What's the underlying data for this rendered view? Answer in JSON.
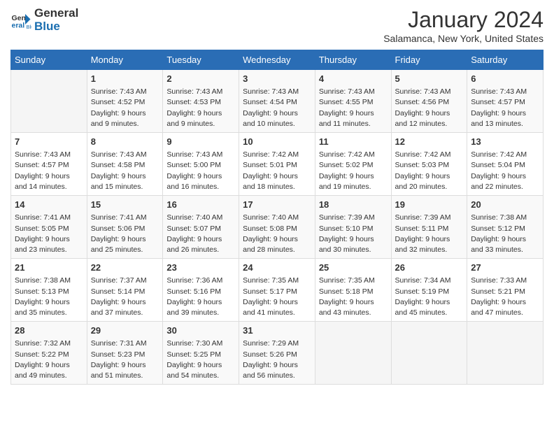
{
  "logo": {
    "line1": "General",
    "line2": "Blue"
  },
  "title": "January 2024",
  "subtitle": "Salamanca, New York, United States",
  "columns": [
    "Sunday",
    "Monday",
    "Tuesday",
    "Wednesday",
    "Thursday",
    "Friday",
    "Saturday"
  ],
  "weeks": [
    [
      {
        "day": "",
        "info": ""
      },
      {
        "day": "1",
        "info": "Sunrise: 7:43 AM\nSunset: 4:52 PM\nDaylight: 9 hours\nand 9 minutes."
      },
      {
        "day": "2",
        "info": "Sunrise: 7:43 AM\nSunset: 4:53 PM\nDaylight: 9 hours\nand 9 minutes."
      },
      {
        "day": "3",
        "info": "Sunrise: 7:43 AM\nSunset: 4:54 PM\nDaylight: 9 hours\nand 10 minutes."
      },
      {
        "day": "4",
        "info": "Sunrise: 7:43 AM\nSunset: 4:55 PM\nDaylight: 9 hours\nand 11 minutes."
      },
      {
        "day": "5",
        "info": "Sunrise: 7:43 AM\nSunset: 4:56 PM\nDaylight: 9 hours\nand 12 minutes."
      },
      {
        "day": "6",
        "info": "Sunrise: 7:43 AM\nSunset: 4:57 PM\nDaylight: 9 hours\nand 13 minutes."
      }
    ],
    [
      {
        "day": "7",
        "info": "Sunrise: 7:43 AM\nSunset: 4:57 PM\nDaylight: 9 hours\nand 14 minutes."
      },
      {
        "day": "8",
        "info": "Sunrise: 7:43 AM\nSunset: 4:58 PM\nDaylight: 9 hours\nand 15 minutes."
      },
      {
        "day": "9",
        "info": "Sunrise: 7:43 AM\nSunset: 5:00 PM\nDaylight: 9 hours\nand 16 minutes."
      },
      {
        "day": "10",
        "info": "Sunrise: 7:42 AM\nSunset: 5:01 PM\nDaylight: 9 hours\nand 18 minutes."
      },
      {
        "day": "11",
        "info": "Sunrise: 7:42 AM\nSunset: 5:02 PM\nDaylight: 9 hours\nand 19 minutes."
      },
      {
        "day": "12",
        "info": "Sunrise: 7:42 AM\nSunset: 5:03 PM\nDaylight: 9 hours\nand 20 minutes."
      },
      {
        "day": "13",
        "info": "Sunrise: 7:42 AM\nSunset: 5:04 PM\nDaylight: 9 hours\nand 22 minutes."
      }
    ],
    [
      {
        "day": "14",
        "info": "Sunrise: 7:41 AM\nSunset: 5:05 PM\nDaylight: 9 hours\nand 23 minutes."
      },
      {
        "day": "15",
        "info": "Sunrise: 7:41 AM\nSunset: 5:06 PM\nDaylight: 9 hours\nand 25 minutes."
      },
      {
        "day": "16",
        "info": "Sunrise: 7:40 AM\nSunset: 5:07 PM\nDaylight: 9 hours\nand 26 minutes."
      },
      {
        "day": "17",
        "info": "Sunrise: 7:40 AM\nSunset: 5:08 PM\nDaylight: 9 hours\nand 28 minutes."
      },
      {
        "day": "18",
        "info": "Sunrise: 7:39 AM\nSunset: 5:10 PM\nDaylight: 9 hours\nand 30 minutes."
      },
      {
        "day": "19",
        "info": "Sunrise: 7:39 AM\nSunset: 5:11 PM\nDaylight: 9 hours\nand 32 minutes."
      },
      {
        "day": "20",
        "info": "Sunrise: 7:38 AM\nSunset: 5:12 PM\nDaylight: 9 hours\nand 33 minutes."
      }
    ],
    [
      {
        "day": "21",
        "info": "Sunrise: 7:38 AM\nSunset: 5:13 PM\nDaylight: 9 hours\nand 35 minutes."
      },
      {
        "day": "22",
        "info": "Sunrise: 7:37 AM\nSunset: 5:14 PM\nDaylight: 9 hours\nand 37 minutes."
      },
      {
        "day": "23",
        "info": "Sunrise: 7:36 AM\nSunset: 5:16 PM\nDaylight: 9 hours\nand 39 minutes."
      },
      {
        "day": "24",
        "info": "Sunrise: 7:35 AM\nSunset: 5:17 PM\nDaylight: 9 hours\nand 41 minutes."
      },
      {
        "day": "25",
        "info": "Sunrise: 7:35 AM\nSunset: 5:18 PM\nDaylight: 9 hours\nand 43 minutes."
      },
      {
        "day": "26",
        "info": "Sunrise: 7:34 AM\nSunset: 5:19 PM\nDaylight: 9 hours\nand 45 minutes."
      },
      {
        "day": "27",
        "info": "Sunrise: 7:33 AM\nSunset: 5:21 PM\nDaylight: 9 hours\nand 47 minutes."
      }
    ],
    [
      {
        "day": "28",
        "info": "Sunrise: 7:32 AM\nSunset: 5:22 PM\nDaylight: 9 hours\nand 49 minutes."
      },
      {
        "day": "29",
        "info": "Sunrise: 7:31 AM\nSunset: 5:23 PM\nDaylight: 9 hours\nand 51 minutes."
      },
      {
        "day": "30",
        "info": "Sunrise: 7:30 AM\nSunset: 5:25 PM\nDaylight: 9 hours\nand 54 minutes."
      },
      {
        "day": "31",
        "info": "Sunrise: 7:29 AM\nSunset: 5:26 PM\nDaylight: 9 hours\nand 56 minutes."
      },
      {
        "day": "",
        "info": ""
      },
      {
        "day": "",
        "info": ""
      },
      {
        "day": "",
        "info": ""
      }
    ]
  ]
}
